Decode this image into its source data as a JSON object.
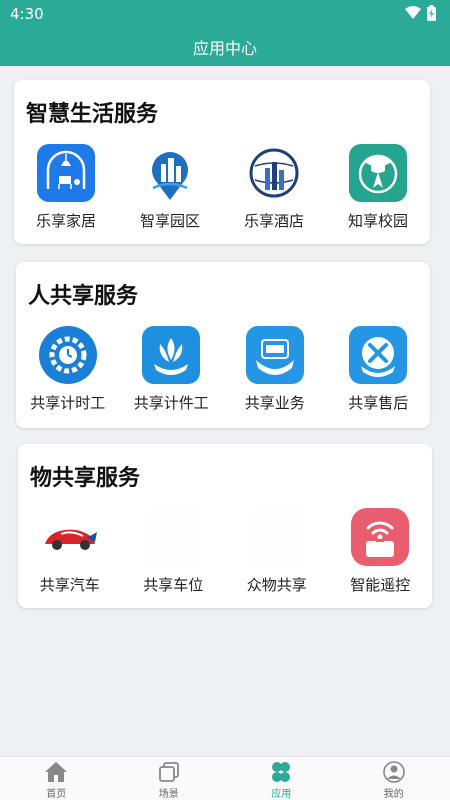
{
  "status": {
    "time": "4:30"
  },
  "header": {
    "title": "应用中心"
  },
  "sections": [
    {
      "title": "智慧生活服务",
      "items": [
        {
          "label": "乐享家居",
          "icon": "home-furniture-icon"
        },
        {
          "label": "智享园区",
          "icon": "park-location-icon"
        },
        {
          "label": "乐享酒店",
          "icon": "hotel-globe-icon"
        },
        {
          "label": "知享校园",
          "icon": "campus-graduation-icon"
        }
      ]
    },
    {
      "title": "人共享服务",
      "items": [
        {
          "label": "共享计时工",
          "icon": "gear-clock-icon"
        },
        {
          "label": "共享计件工",
          "icon": "lotus-hand-icon"
        },
        {
          "label": "共享业务",
          "icon": "business-shield-icon"
        },
        {
          "label": "共享售后",
          "icon": "tools-repair-icon"
        }
      ]
    },
    {
      "title": "物共享服务",
      "items": [
        {
          "label": "共享汽车",
          "icon": "car-icon"
        },
        {
          "label": "共享车位",
          "icon": "parking-icon"
        },
        {
          "label": "众物共享",
          "icon": "goods-share-icon"
        },
        {
          "label": "智能遥控",
          "icon": "wifi-remote-icon"
        }
      ]
    }
  ],
  "tabs": [
    {
      "label": "首页",
      "icon": "house-icon",
      "active": false
    },
    {
      "label": "场景",
      "icon": "layers-icon",
      "active": false
    },
    {
      "label": "应用",
      "icon": "clover-icon",
      "active": true
    },
    {
      "label": "我的",
      "icon": "user-icon",
      "active": false
    }
  ],
  "colors": {
    "brand": "#2aaa97",
    "background": "#eef0f3"
  }
}
